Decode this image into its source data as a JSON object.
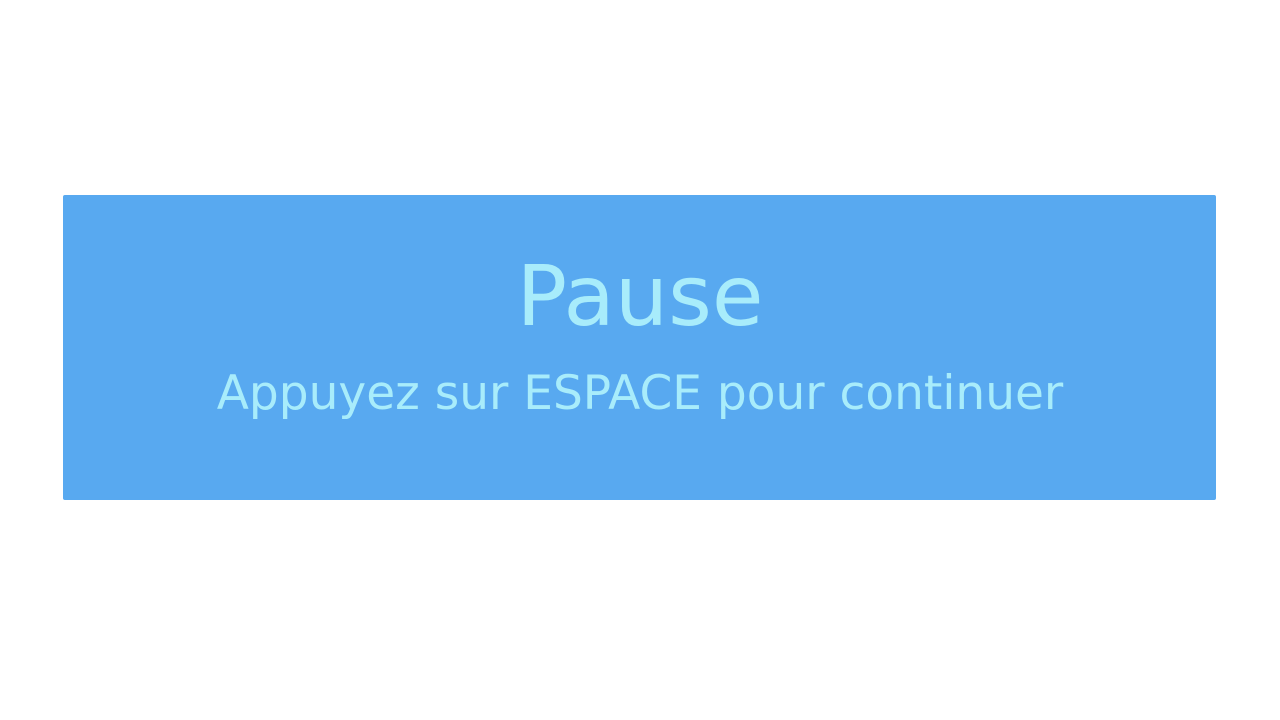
{
  "pause_overlay": {
    "title": "Pause",
    "hint": "Appuyez sur ESPACE pour continuer"
  },
  "colors": {
    "background": "#ffffff",
    "panel": "#58a9f0",
    "text": "#a8ecfb"
  }
}
